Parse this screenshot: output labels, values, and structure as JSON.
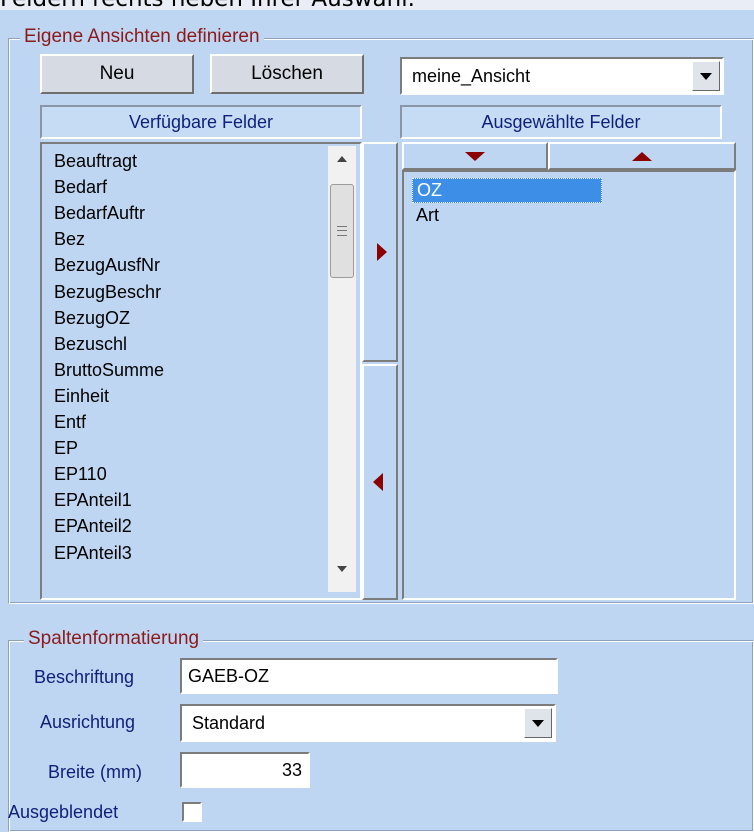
{
  "top_text": "Feldern rechts neben Ihrer Auswahl.",
  "views_group": {
    "legend": "Eigene Ansichten definieren",
    "new_button": "Neu",
    "delete_button": "Löschen",
    "view_select": "meine_Ansicht",
    "available_header": "Verfügbare Felder",
    "selected_header": "Ausgewählte Felder",
    "available_fields": [
      "Beauftragt",
      "Bedarf",
      "BedarfAuftr",
      "Bez",
      "BezugAusfNr",
      "BezugBeschr",
      "BezugOZ",
      "Bezuschl",
      "BruttoSumme",
      "Einheit",
      "Entf",
      "EP",
      "EP110",
      "EPAnteil1",
      "EPAnteil2",
      "EPAnteil3"
    ],
    "selected_fields": [
      "OZ",
      "Art"
    ],
    "selected_index": 0
  },
  "format_group": {
    "legend": "Spaltenformatierung",
    "caption_label": "Beschriftung",
    "caption_value": "GAEB-OZ",
    "alignment_label": "Ausrichtung",
    "alignment_value": "Standard",
    "width_label": "Breite (mm)",
    "width_value": "33",
    "hidden_label": "Ausgeblendet",
    "hidden_checked": false
  },
  "icons": {
    "add": "arrow-right-icon",
    "remove": "arrow-left-icon",
    "move_down": "arrow-down-icon",
    "move_up": "arrow-up-icon"
  },
  "colors": {
    "background": "#bfd6f2",
    "legend_text": "#8b1a1a",
    "label_text": "#0f1f7a",
    "selection": "#3d8ee6",
    "arrow": "#8b0000"
  }
}
